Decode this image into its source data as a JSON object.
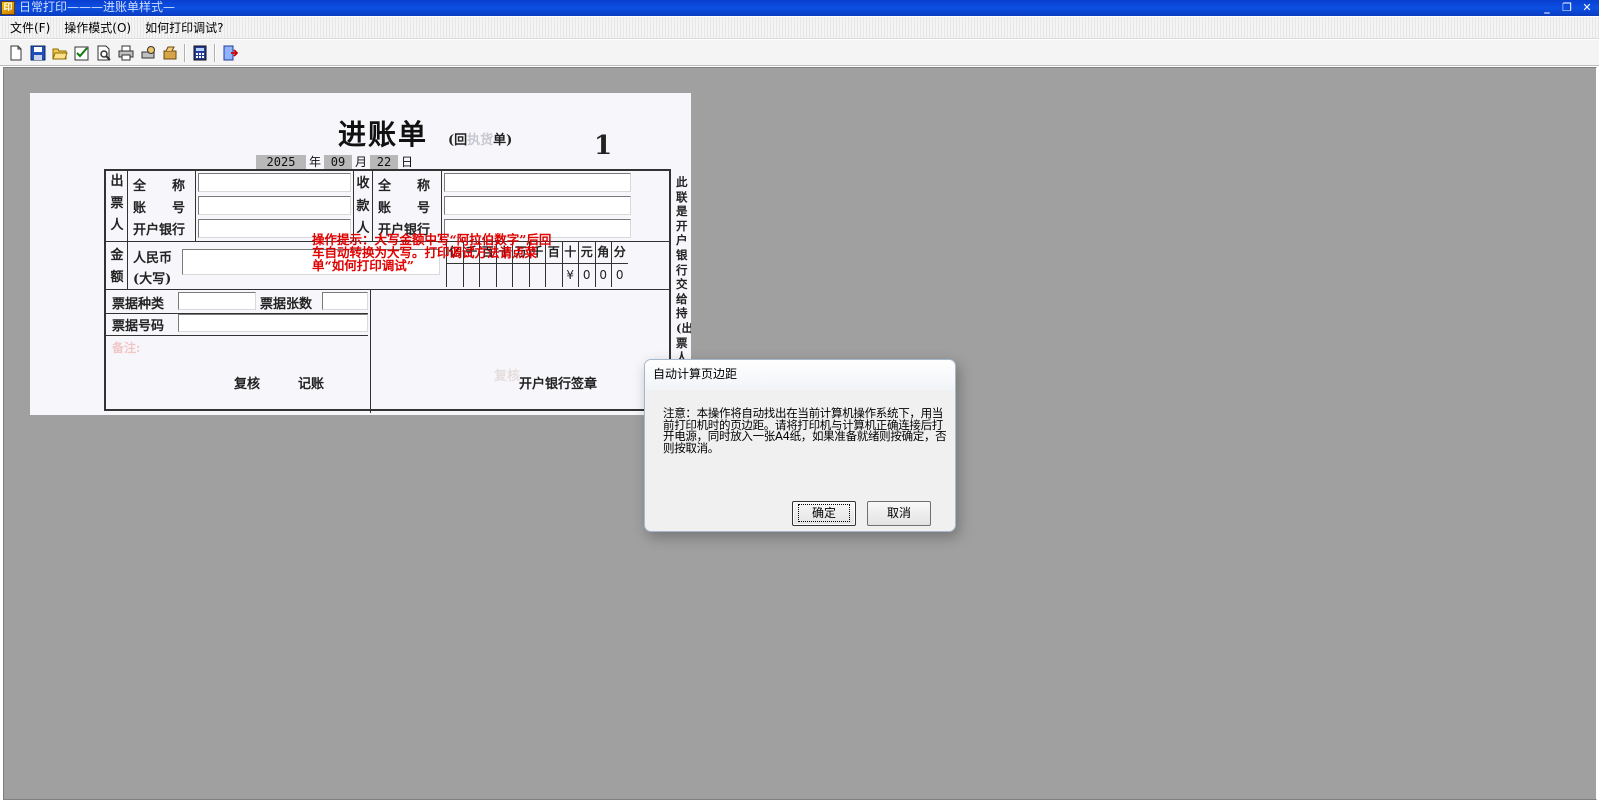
{
  "window": {
    "title": "日常打印———进账单样式—",
    "app_icon": "app-icon",
    "controls": [
      "minimize-icon",
      "restore-icon",
      "close-icon"
    ]
  },
  "menu": {
    "items": [
      {
        "label": "文件(F)"
      },
      {
        "label": "操作模式(O)"
      },
      {
        "label": "如何打印调试?"
      }
    ]
  },
  "toolbar": {
    "buttons": [
      "new-icon",
      "save-icon",
      "open-icon",
      "check-icon",
      "preview-icon",
      "print-icon",
      "print-setup-icon",
      "batch-icon",
      "calculator-icon",
      "exit-icon"
    ]
  },
  "document": {
    "title": "进账单",
    "subtitle_open": "(回",
    "subtitle_faint": "执货",
    "subtitle_close": "单)",
    "number": "1",
    "date": {
      "year": "2025",
      "year_label": "年",
      "month": "09",
      "month_label": "月",
      "day": "22",
      "day_label": "日"
    },
    "payer": {
      "vertical_label": [
        "出",
        "票",
        "人"
      ],
      "name_label": "全　　称",
      "account_label": "账　　号",
      "bank_label": "开户银行"
    },
    "payee": {
      "vertical_label": [
        "收",
        "款",
        "人"
      ],
      "name_label": "全　　称",
      "account_label": "账　　号",
      "bank_label": "开户银行"
    },
    "amount": {
      "vertical_label": [
        "金",
        "额"
      ],
      "rmb_label": "人民币",
      "caps_label": "(大写)",
      "digit_headers": [
        "亿",
        "千",
        "百",
        "十",
        "万",
        "千",
        "百",
        "十",
        "元",
        "角",
        "分"
      ],
      "digit_values": [
        "",
        "",
        "",
        "",
        "",
        "",
        "",
        "¥",
        "0",
        "0",
        "0"
      ]
    },
    "bill_type_label": "票据种类",
    "bill_count_label": "票据张数",
    "bill_number_label": "票据号码",
    "remark_label": "备注:",
    "review_label": "复核",
    "bookkeep_label": "记账",
    "faint_review": "复核",
    "bank_seal_label": "开户银行签章",
    "hint": "操作提示：大写金额中写“阿拉伯数字”后回车自动转换为大写。打印调试方法请点菜单“如何打印调试”",
    "side_note": "此联是开户银行交给持(出)票人的回单"
  },
  "dialog": {
    "title": "自动计算页边距",
    "message": "注意：本操作将自动找出在当前计算机操作系统下，用当前打印机时的页边距。请将打印机与计算机正确连接后打开电源，同时放入一张A4纸，如果准备就绪则按确定，否则按取消。",
    "ok_label": "确定",
    "cancel_label": "取消"
  }
}
